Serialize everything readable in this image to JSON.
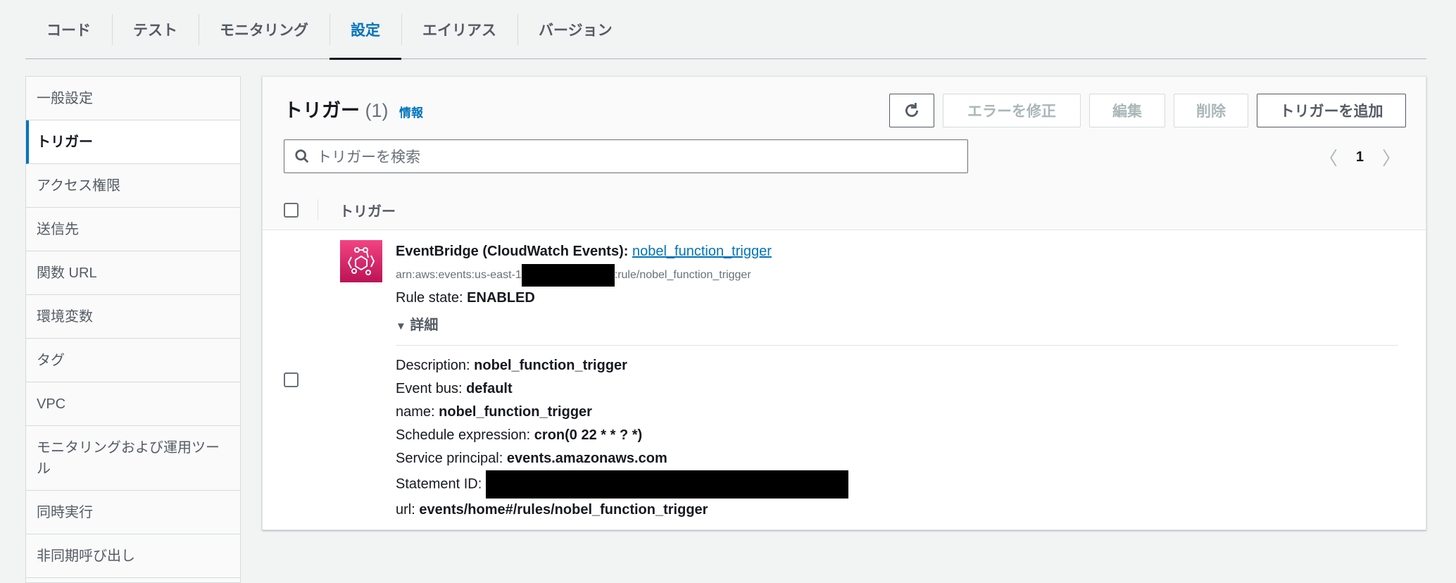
{
  "tabs": [
    "コード",
    "テスト",
    "モニタリング",
    "設定",
    "エイリアス",
    "バージョン"
  ],
  "sidebar": [
    "一般設定",
    "トリガー",
    "アクセス権限",
    "送信先",
    "関数 URL",
    "環境変数",
    "タグ",
    "VPC",
    "モニタリングおよび運用ツール",
    "同時実行",
    "非同期呼び出し"
  ],
  "panel": {
    "title": "トリガー",
    "count": "(1)",
    "info": "情報",
    "buttons": {
      "fix": "エラーを修正",
      "edit": "編集",
      "delete": "削除",
      "add": "トリガーを追加"
    },
    "search_placeholder": "トリガーを検索",
    "page": "1",
    "column": "トリガー"
  },
  "trigger": {
    "type": "EventBridge (CloudWatch Events):",
    "name": "nobel_function_trigger",
    "arn_prefix": "arn:aws:events:us-east-1",
    "arn_suffix": ":rule/nobel_function_trigger",
    "state_label": "Rule state:",
    "state": "ENABLED",
    "details": "詳細",
    "fields": [
      [
        "Description:",
        "nobel_function_trigger"
      ],
      [
        "Event bus:",
        "default"
      ],
      [
        "name:",
        "nobel_function_trigger"
      ],
      [
        "Schedule expression:",
        "cron(0 22 * * ? *)"
      ],
      [
        "Service principal:",
        "events.amazonaws.com"
      ],
      [
        "Statement ID:",
        ""
      ],
      [
        "url:",
        "events/home#/rules/nobel_function_trigger"
      ]
    ]
  },
  "colors": {
    "accent": "#0073bb",
    "eventbridge": "#e7157b"
  }
}
